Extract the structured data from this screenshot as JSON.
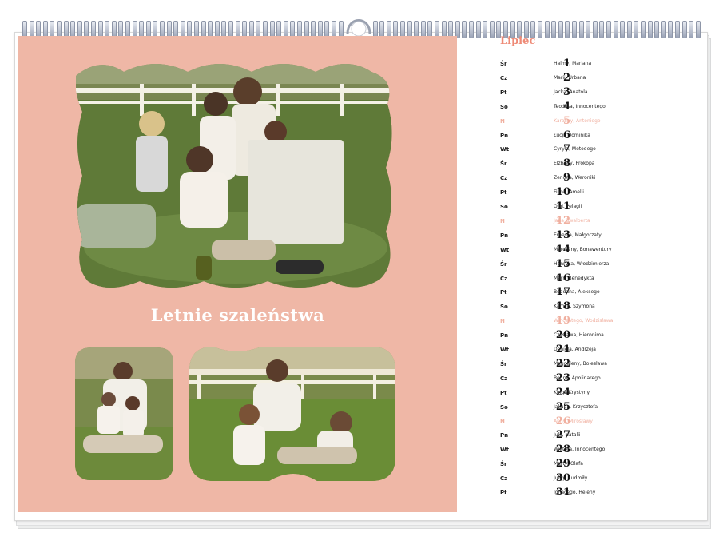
{
  "colors": {
    "panel": "#efb7a6",
    "accent": "#ee8a76",
    "sunday": "#f0b0a0"
  },
  "left_page": {
    "caption": "Letnie szaleństwa"
  },
  "calendar": {
    "month": "Lipiec",
    "days": [
      {
        "wd": "Śr",
        "day": "1",
        "names": "Halmy, Mariana",
        "sunday": false
      },
      {
        "wd": "Cz",
        "day": "2",
        "names": "Marii, Urbana",
        "sunday": false
      },
      {
        "wd": "Pt",
        "day": "3",
        "names": "Jacka, Anatola",
        "sunday": false
      },
      {
        "wd": "So",
        "day": "4",
        "names": "Teodora, Innocentego",
        "sunday": false
      },
      {
        "wd": "N",
        "day": "5",
        "names": "Karoliny, Antoniego",
        "sunday": true
      },
      {
        "wd": "Pn",
        "day": "6",
        "names": "Łucji, Dominika",
        "sunday": false
      },
      {
        "wd": "Wt",
        "day": "7",
        "names": "Cyryla, Metodego",
        "sunday": false
      },
      {
        "wd": "Śr",
        "day": "8",
        "names": "Elżbiety, Prokopa",
        "sunday": false
      },
      {
        "wd": "Cz",
        "day": "9",
        "names": "Zenona, Weroniki",
        "sunday": false
      },
      {
        "wd": "Pt",
        "day": "10",
        "names": "Filipa, Amelii",
        "sunday": false
      },
      {
        "wd": "So",
        "day": "11",
        "names": "Olgi, Pelagii",
        "sunday": false
      },
      {
        "wd": "N",
        "day": "12",
        "names": "Jana Gwalberta",
        "sunday": true
      },
      {
        "wd": "Pn",
        "day": "13",
        "names": "Ernesta, Małgorzaty",
        "sunday": false
      },
      {
        "wd": "Wt",
        "day": "14",
        "names": "Marceliny, Bonawentury",
        "sunday": false
      },
      {
        "wd": "Śr",
        "day": "15",
        "names": "Henryka, Włodzimierza",
        "sunday": false
      },
      {
        "wd": "Cz",
        "day": "16",
        "names": "Marii, Benedykta",
        "sunday": false
      },
      {
        "wd": "Pt",
        "day": "17",
        "names": "Bogdana, Aleksego",
        "sunday": false
      },
      {
        "wd": "So",
        "day": "18",
        "names": "Kamila, Szymona",
        "sunday": false
      },
      {
        "wd": "N",
        "day": "19",
        "names": "Wincentego, Wodzisława",
        "sunday": true
      },
      {
        "wd": "Pn",
        "day": "20",
        "names": "Czesława, Hieronima",
        "sunday": false
      },
      {
        "wd": "Wt",
        "day": "21",
        "names": "Daniela, Andrzeja",
        "sunday": false
      },
      {
        "wd": "Śr",
        "day": "22",
        "names": "Magdaleny, Bolesława",
        "sunday": false
      },
      {
        "wd": "Cz",
        "day": "23",
        "names": "Bogny, Apolinarego",
        "sunday": false
      },
      {
        "wd": "Pt",
        "day": "24",
        "names": "Kingi, Krystyny",
        "sunday": false
      },
      {
        "wd": "So",
        "day": "25",
        "names": "Jakuba, Krzysztofa",
        "sunday": false
      },
      {
        "wd": "N",
        "day": "26",
        "names": "Anny, Mirosławy",
        "sunday": true
      },
      {
        "wd": "Pn",
        "day": "27",
        "names": "Julii, Natalii",
        "sunday": false
      },
      {
        "wd": "Wt",
        "day": "28",
        "names": "Wiktora, Innocentego",
        "sunday": false
      },
      {
        "wd": "Śr",
        "day": "29",
        "names": "Marty, Olafa",
        "sunday": false
      },
      {
        "wd": "Cz",
        "day": "30",
        "names": "Julity, Ludmiły",
        "sunday": false
      },
      {
        "wd": "Pt",
        "day": "31",
        "names": "Ignacego, Heleny",
        "sunday": false
      }
    ]
  }
}
